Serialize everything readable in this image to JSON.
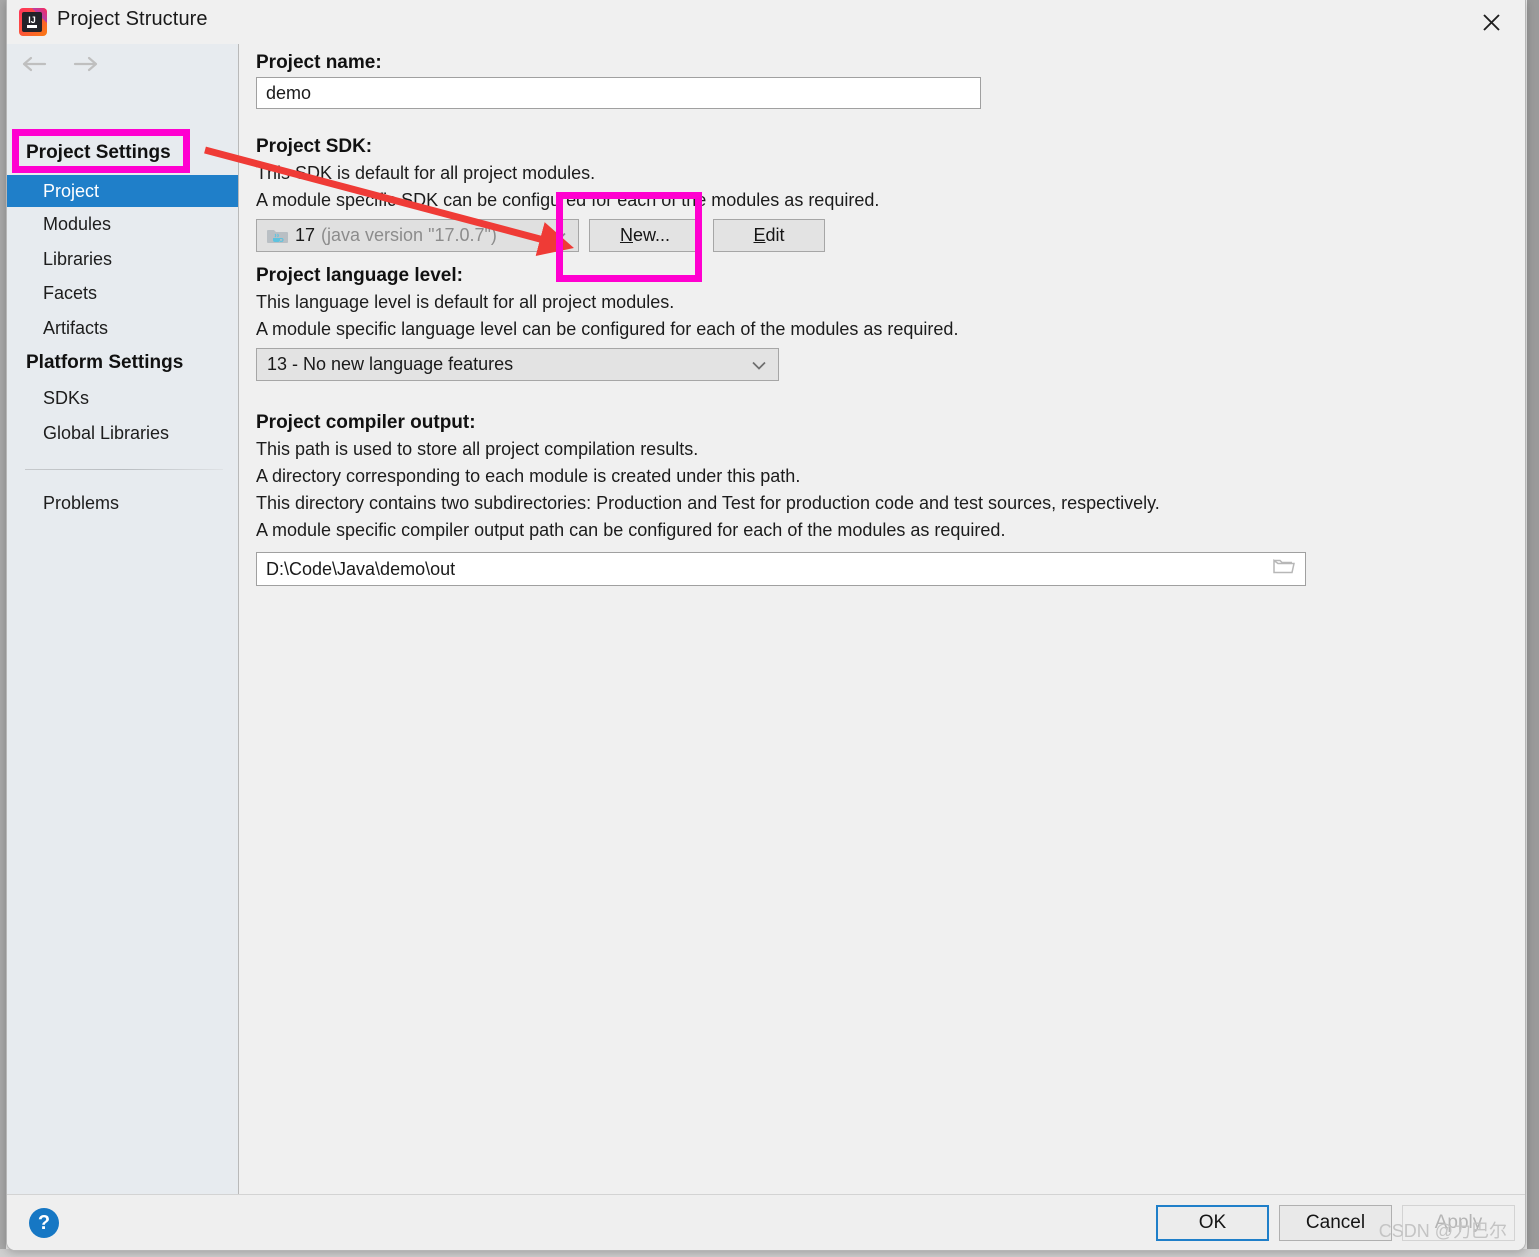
{
  "window": {
    "title": "Project Structure",
    "app_icon": "intellij-idea-icon",
    "close_icon": "close-icon",
    "back_icon": "back-arrow-icon",
    "forward_icon": "forward-arrow-icon"
  },
  "sidebar": {
    "groups": [
      {
        "header": "Project Settings",
        "items": [
          {
            "label": "Project",
            "selected": true
          },
          {
            "label": "Modules",
            "selected": false
          },
          {
            "label": "Libraries",
            "selected": false
          },
          {
            "label": "Facets",
            "selected": false
          },
          {
            "label": "Artifacts",
            "selected": false
          }
        ]
      },
      {
        "header": "Platform Settings",
        "items": [
          {
            "label": "SDKs",
            "selected": false
          },
          {
            "label": "Global Libraries",
            "selected": false
          }
        ]
      }
    ],
    "extra_items": [
      {
        "label": "Problems",
        "selected": false
      }
    ]
  },
  "main": {
    "project_name": {
      "label": "Project name:",
      "value": "demo"
    },
    "project_sdk": {
      "label": "Project SDK:",
      "desc1": "This SDK is default for all project modules.",
      "desc2": "A module specific SDK can be configured for each of the modules as required.",
      "selected_version": "17",
      "selected_detail": "(java version \"17.0.7\")",
      "sdk_icon": "java-sdk-folder-icon",
      "chevron_icon": "chevron-down-icon",
      "new_button": "New...",
      "new_button_mnemonic": "N",
      "new_button_rest": "ew...",
      "edit_button": "Edit",
      "edit_button_mnemonic": "E",
      "edit_button_rest": "dit"
    },
    "language_level": {
      "label": "Project language level:",
      "desc1": "This language level is default for all project modules.",
      "desc2": "A module specific language level can be configured for each of the modules as required.",
      "value": "13 - No new language features",
      "chevron_icon": "chevron-down-icon"
    },
    "compiler_output": {
      "label": "Project compiler output:",
      "desc1": "This path is used to store all project compilation results.",
      "desc2": "A directory corresponding to each module is created under this path.",
      "desc3": "This directory contains two subdirectories: Production and Test for production code and test sources, respectively.",
      "desc4": "A module specific compiler output path can be configured for each of the modules as required.",
      "value": "D:\\Code\\Java\\demo\\out",
      "browse_icon": "folder-browse-icon"
    }
  },
  "footer": {
    "help_icon": "?",
    "ok": "OK",
    "cancel": "Cancel",
    "apply": "Apply",
    "apply_enabled": false,
    "watermark": "CSDN @力巴尔"
  },
  "annotations": {
    "highlight_color": "#ff00d0",
    "arrow_color": "#ef3b36",
    "boxes": [
      {
        "name": "project-sidebar-highlight"
      },
      {
        "name": "new-sdk-button-highlight"
      }
    ],
    "arrow": {
      "name": "pointer-arrow",
      "from": "Project sidebar item",
      "to": "Project SDK dropdown"
    }
  },
  "colors": {
    "selection_blue": "#1f7fc9",
    "sidebar_bg": "#e7ebef",
    "dialog_bg": "#f0f0f0",
    "help_blue": "#1677c4"
  }
}
